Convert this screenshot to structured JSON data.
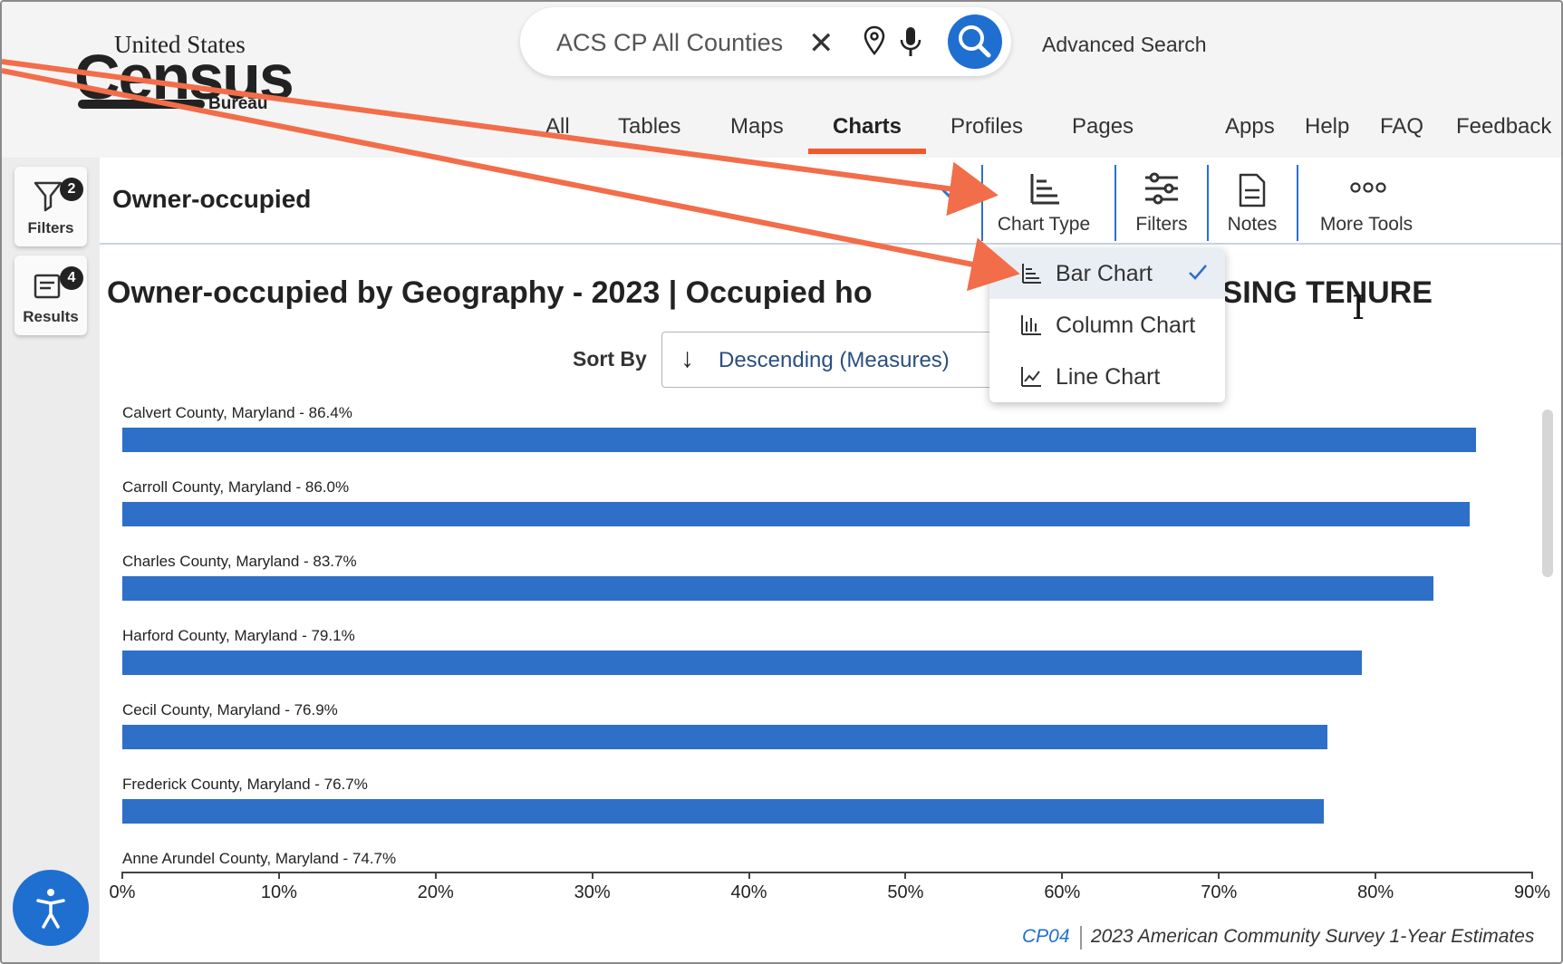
{
  "header": {
    "logo": {
      "line1": "United States",
      "reg": "®",
      "line2": "Census",
      "line3": "Bureau"
    },
    "search": {
      "value": "ACS CP All Counties",
      "placeholder": "Search"
    },
    "advanced_search": "Advanced Search",
    "tabs": [
      {
        "label": "All"
      },
      {
        "label": "Tables"
      },
      {
        "label": "Maps"
      },
      {
        "label": "Charts",
        "active": true
      },
      {
        "label": "Profiles"
      },
      {
        "label": "Pages"
      }
    ],
    "links": [
      {
        "label": "Apps"
      },
      {
        "label": "Help"
      },
      {
        "label": "FAQ"
      },
      {
        "label": "Feedback"
      }
    ]
  },
  "rail": {
    "filters": {
      "label": "Filters",
      "count": "2"
    },
    "results": {
      "label": "Results",
      "count": "4"
    }
  },
  "toolbar": {
    "measure": "Owner-occupied",
    "tools": [
      {
        "label": "Chart Type",
        "icon": "bar-chart-icon"
      },
      {
        "label": "Filters",
        "icon": "sliders-icon"
      },
      {
        "label": "Notes",
        "icon": "document-icon"
      },
      {
        "label": "More Tools",
        "icon": "more-dots-icon"
      }
    ]
  },
  "chart_menu": {
    "items": [
      {
        "label": "Bar Chart",
        "icon": "bar-chart-icon",
        "selected": true
      },
      {
        "label": "Column Chart",
        "icon": "column-chart-icon",
        "selected": false
      },
      {
        "label": "Line Chart",
        "icon": "line-chart-icon",
        "selected": false
      }
    ]
  },
  "sort": {
    "label": "Sort By",
    "value": "Descending (Measures)"
  },
  "chart_data": {
    "type": "bar",
    "title_visible_left": "Owner-occupied by Geography - 2023 | Occupied ho",
    "title_visible_right": "USING TENURE",
    "categories": [
      "Calvert County, Maryland",
      "Carroll County, Maryland",
      "Charles County, Maryland",
      "Harford County, Maryland",
      "Cecil County, Maryland",
      "Frederick County, Maryland",
      "Anne Arundel County, Maryland"
    ],
    "labels": [
      "Calvert County, Maryland - 86.4%",
      "Carroll County, Maryland - 86.0%",
      "Charles County, Maryland - 83.7%",
      "Harford County, Maryland - 79.1%",
      "Cecil County, Maryland - 76.9%",
      "Frederick County, Maryland - 76.7%",
      "Anne Arundel County, Maryland - 74.7%"
    ],
    "values": [
      86.4,
      86.0,
      83.7,
      79.1,
      76.9,
      76.7,
      74.7
    ],
    "xlim": [
      0,
      90
    ],
    "xticks": [
      "0%",
      "10%",
      "20%",
      "30%",
      "40%",
      "50%",
      "60%",
      "70%",
      "80%",
      "90%"
    ],
    "bar_color": "#2e6fc8",
    "grid": false
  },
  "footer": {
    "code": "CP04",
    "source": "2023 American Community Survey 1-Year Estimates"
  },
  "colors": {
    "accent_blue": "#1f6fd1",
    "tab_underline": "#f05a28",
    "annotation_arrow": "#f26d4a"
  }
}
